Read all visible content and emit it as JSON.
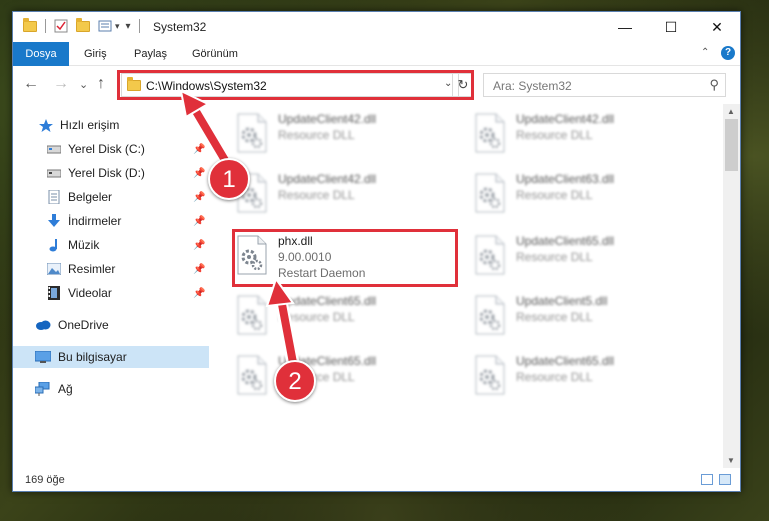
{
  "window": {
    "title": "System32",
    "qa_dropdown": "▾",
    "controls": {
      "minimize": "—",
      "maximize": "☐",
      "close": "✕"
    }
  },
  "ribbon": {
    "tabs": [
      "Dosya",
      "Giriş",
      "Paylaş",
      "Görünüm"
    ],
    "help": "?",
    "collapse": "⌃"
  },
  "address": {
    "back": "←",
    "forward": "→",
    "recent": "⌄",
    "up": "↑",
    "path": "C:\\Windows\\System32",
    "dropdown": "⌄",
    "refresh": "↻"
  },
  "search": {
    "placeholder": "Ara: System32",
    "icon": "⚲"
  },
  "nav": {
    "items": [
      {
        "label": "Hızlı erişim",
        "icon": "star-icon"
      },
      {
        "label": "Yerel Disk (C:)",
        "icon": "drive-icon",
        "pinned": true
      },
      {
        "label": "Yerel Disk (D:)",
        "icon": "drive-icon",
        "pinned": true
      },
      {
        "label": "Belgeler",
        "icon": "documents-icon",
        "pinned": true
      },
      {
        "label": "İndirmeler",
        "icon": "download-icon",
        "pinned": true
      },
      {
        "label": "Müzik",
        "icon": "music-icon",
        "pinned": true
      },
      {
        "label": "Resimler",
        "icon": "pictures-icon",
        "pinned": true
      },
      {
        "label": "Videolar",
        "icon": "videos-icon",
        "pinned": true
      },
      {
        "label": "OneDrive",
        "icon": "cloud-icon"
      },
      {
        "label": "Bu bilgisayar",
        "icon": "computer-icon",
        "selected": true
      },
      {
        "label": "Ağ",
        "icon": "network-icon"
      }
    ],
    "pin_glyph": "📌"
  },
  "files": [
    {
      "name": "UpdateClient42.dll",
      "sub1": "Resource DLL",
      "blurred": true
    },
    {
      "name": "UpdateClient42.dll",
      "sub1": "Resource DLL",
      "blurred": true
    },
    {
      "name": "UpdateClient42.dll",
      "sub1": "Resource DLL",
      "blurred": true
    },
    {
      "name": "UpdateClient63.dll",
      "sub1": "Resource DLL",
      "blurred": true
    },
    {
      "name": "phx.dll",
      "sub1": "9.00.0010",
      "sub2": "Restart Daemon",
      "blurred": false
    },
    {
      "name": "UpdateClient65.dll",
      "sub1": "Resource DLL",
      "blurred": true
    },
    {
      "name": "UpdateClient65.dll",
      "sub1": "Resource DLL",
      "blurred": true
    },
    {
      "name": "UpdateClient5.dll",
      "sub1": "Resource DLL",
      "blurred": true
    },
    {
      "name": "UpdateClient65.dll",
      "sub1": "Resource DLL",
      "blurred": true
    },
    {
      "name": "UpdateClient65.dll",
      "sub1": "Resource DLL",
      "blurred": true
    }
  ],
  "status": {
    "count": "169 öğe"
  },
  "callouts": [
    "1",
    "2"
  ],
  "colors": {
    "accent": "#1979ca",
    "highlight": "#e0303a",
    "selected": "#cce4f7"
  }
}
